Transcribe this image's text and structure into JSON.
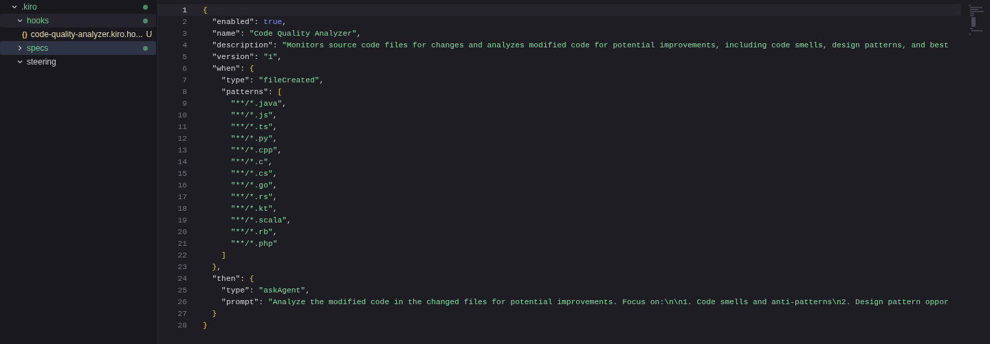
{
  "explorer": {
    "items": [
      {
        "label": ".kiro",
        "kind": "folder",
        "expanded": true,
        "selected": false,
        "highlighted": false,
        "changed": true,
        "children": [
          {
            "label": "hooks",
            "kind": "folder",
            "expanded": true,
            "selected": false,
            "highlighted": true,
            "changed": true,
            "children": [
              {
                "label": "code-quality-analyzer.kiro.ho...",
                "kind": "file",
                "icon": "{}",
                "badge": "U",
                "selected": false,
                "highlighted": false
              }
            ]
          },
          {
            "label": "specs",
            "kind": "folder",
            "expanded": false,
            "selected": true,
            "highlighted": false,
            "changed": true
          },
          {
            "label": "steering",
            "kind": "folder",
            "expanded": true,
            "selected": false,
            "highlighted": false,
            "changed": false
          }
        ]
      }
    ]
  },
  "editor": {
    "lines": [
      {
        "number": "1",
        "current": true,
        "tokens": [
          {
            "kind": "brace",
            "text": "{"
          }
        ]
      },
      {
        "number": "2",
        "current": false,
        "tokens": [
          {
            "kind": "key",
            "text": "  \"enabled\""
          },
          {
            "kind": "punct",
            "text": ": "
          },
          {
            "kind": "bool",
            "text": "true"
          },
          {
            "kind": "punct",
            "text": ","
          }
        ]
      },
      {
        "number": "3",
        "current": false,
        "tokens": [
          {
            "kind": "key",
            "text": "  \"name\""
          },
          {
            "kind": "punct",
            "text": ": "
          },
          {
            "kind": "string",
            "text": "\"Code Quality Analyzer\""
          },
          {
            "kind": "punct",
            "text": ","
          }
        ]
      },
      {
        "number": "4",
        "current": false,
        "tokens": [
          {
            "kind": "key",
            "text": "  \"description\""
          },
          {
            "kind": "punct",
            "text": ": "
          },
          {
            "kind": "string",
            "text": "\"Monitors source code files for changes and analyzes modified code for potential improvements, including code smells, design patterns, and best"
          }
        ]
      },
      {
        "number": "5",
        "current": false,
        "tokens": [
          {
            "kind": "key",
            "text": "  \"version\""
          },
          {
            "kind": "punct",
            "text": ": "
          },
          {
            "kind": "string",
            "text": "\"1\""
          },
          {
            "kind": "punct",
            "text": ","
          }
        ]
      },
      {
        "number": "6",
        "current": false,
        "tokens": [
          {
            "kind": "key",
            "text": "  \"when\""
          },
          {
            "kind": "punct",
            "text": ": "
          },
          {
            "kind": "brace",
            "text": "{"
          }
        ]
      },
      {
        "number": "7",
        "current": false,
        "tokens": [
          {
            "kind": "key",
            "text": "    \"type\""
          },
          {
            "kind": "punct",
            "text": ": "
          },
          {
            "kind": "string",
            "text": "\"fileCreated\""
          },
          {
            "kind": "punct",
            "text": ","
          }
        ]
      },
      {
        "number": "8",
        "current": false,
        "tokens": [
          {
            "kind": "key",
            "text": "    \"patterns\""
          },
          {
            "kind": "punct",
            "text": ": "
          },
          {
            "kind": "bracket",
            "text": "["
          }
        ]
      },
      {
        "number": "9",
        "current": false,
        "tokens": [
          {
            "kind": "string",
            "text": "      \"**/*.java\""
          },
          {
            "kind": "punct",
            "text": ","
          }
        ]
      },
      {
        "number": "10",
        "current": false,
        "tokens": [
          {
            "kind": "string",
            "text": "      \"**/*.js\""
          },
          {
            "kind": "punct",
            "text": ","
          }
        ]
      },
      {
        "number": "11",
        "current": false,
        "tokens": [
          {
            "kind": "string",
            "text": "      \"**/*.ts\""
          },
          {
            "kind": "punct",
            "text": ","
          }
        ]
      },
      {
        "number": "12",
        "current": false,
        "tokens": [
          {
            "kind": "string",
            "text": "      \"**/*.py\""
          },
          {
            "kind": "punct",
            "text": ","
          }
        ]
      },
      {
        "number": "13",
        "current": false,
        "tokens": [
          {
            "kind": "string",
            "text": "      \"**/*.cpp\""
          },
          {
            "kind": "punct",
            "text": ","
          }
        ]
      },
      {
        "number": "14",
        "current": false,
        "tokens": [
          {
            "kind": "string",
            "text": "      \"**/*.c\""
          },
          {
            "kind": "punct",
            "text": ","
          }
        ]
      },
      {
        "number": "15",
        "current": false,
        "tokens": [
          {
            "kind": "string",
            "text": "      \"**/*.cs\""
          },
          {
            "kind": "punct",
            "text": ","
          }
        ]
      },
      {
        "number": "16",
        "current": false,
        "tokens": [
          {
            "kind": "string",
            "text": "      \"**/*.go\""
          },
          {
            "kind": "punct",
            "text": ","
          }
        ]
      },
      {
        "number": "17",
        "current": false,
        "tokens": [
          {
            "kind": "string",
            "text": "      \"**/*.rs\""
          },
          {
            "kind": "punct",
            "text": ","
          }
        ]
      },
      {
        "number": "18",
        "current": false,
        "tokens": [
          {
            "kind": "string",
            "text": "      \"**/*.kt\""
          },
          {
            "kind": "punct",
            "text": ","
          }
        ]
      },
      {
        "number": "19",
        "current": false,
        "tokens": [
          {
            "kind": "string",
            "text": "      \"**/*.scala\""
          },
          {
            "kind": "punct",
            "text": ","
          }
        ]
      },
      {
        "number": "20",
        "current": false,
        "tokens": [
          {
            "kind": "string",
            "text": "      \"**/*.rb\""
          },
          {
            "kind": "punct",
            "text": ","
          }
        ]
      },
      {
        "number": "21",
        "current": false,
        "tokens": [
          {
            "kind": "string",
            "text": "      \"**/*.php\""
          }
        ]
      },
      {
        "number": "22",
        "current": false,
        "tokens": [
          {
            "kind": "bracket",
            "text": "    ]"
          }
        ]
      },
      {
        "number": "23",
        "current": false,
        "tokens": [
          {
            "kind": "brace",
            "text": "  }"
          },
          {
            "kind": "punct",
            "text": ","
          }
        ]
      },
      {
        "number": "24",
        "current": false,
        "tokens": [
          {
            "kind": "key",
            "text": "  \"then\""
          },
          {
            "kind": "punct",
            "text": ": "
          },
          {
            "kind": "brace",
            "text": "{"
          }
        ]
      },
      {
        "number": "25",
        "current": false,
        "tokens": [
          {
            "kind": "key",
            "text": "    \"type\""
          },
          {
            "kind": "punct",
            "text": ": "
          },
          {
            "kind": "string",
            "text": "\"askAgent\""
          },
          {
            "kind": "punct",
            "text": ","
          }
        ]
      },
      {
        "number": "26",
        "current": false,
        "tokens": [
          {
            "kind": "key",
            "text": "    \"prompt\""
          },
          {
            "kind": "punct",
            "text": ": "
          },
          {
            "kind": "string",
            "text": "\"Analyze the modified code in the changed files for potential improvements. Focus on:\\n\\n1. Code smells and anti-patterns\\n2. Design pattern oppor"
          }
        ]
      },
      {
        "number": "27",
        "current": false,
        "tokens": [
          {
            "kind": "brace",
            "text": "  }"
          }
        ]
      },
      {
        "number": "28",
        "current": false,
        "tokens": [
          {
            "kind": "brace",
            "text": "}"
          }
        ]
      }
    ]
  }
}
